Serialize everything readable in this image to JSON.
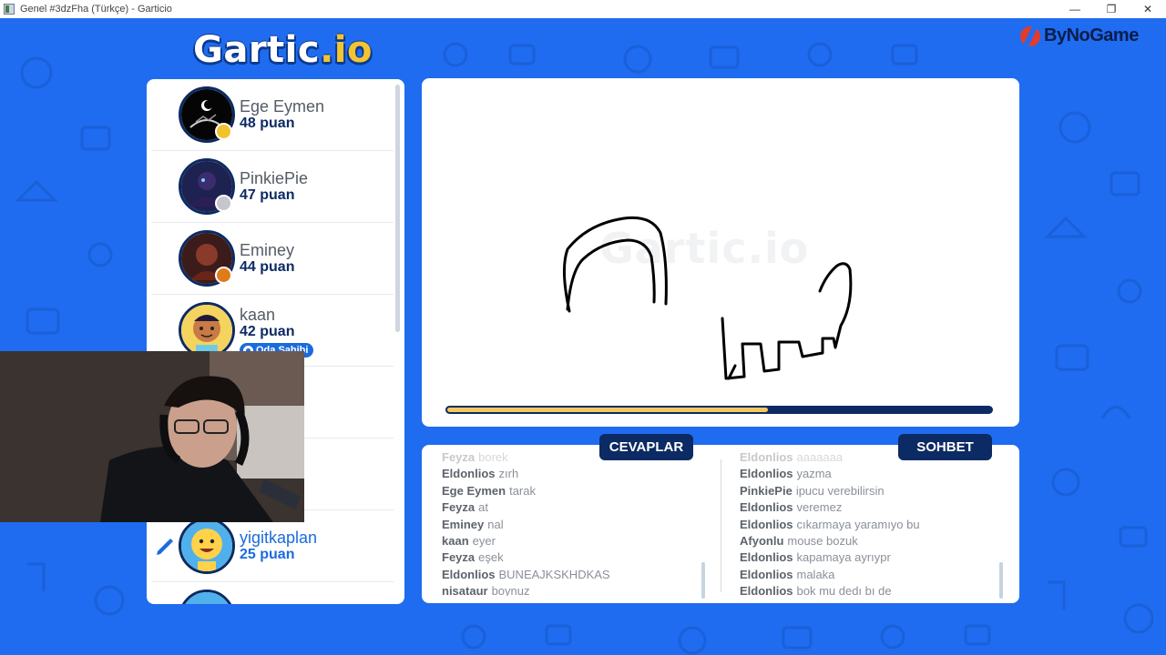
{
  "window": {
    "title": "Genel #3dzFha (Türkçe) - Garticio",
    "min_icon": "minimize-icon",
    "max_icon": "maximize-icon",
    "close_icon": "close-icon"
  },
  "logo": {
    "main": "Gartic",
    "suffix": ".io"
  },
  "sponsor": {
    "label": "ByNoGame"
  },
  "players": [
    {
      "name": "Ege Eymen",
      "score": "48 puan",
      "medal_color": "#f2c12e"
    },
    {
      "name": "PinkiePie",
      "score": "47 puan",
      "medal_color": "#c5c7cc"
    },
    {
      "name": "Eminey",
      "score": "44 puan",
      "medal_color": "#e07b1a"
    },
    {
      "name": "kaan",
      "score": "42 puan",
      "badge": "Oda Sahibi"
    },
    {
      "name": "yigitkaplan",
      "score": "25 puan",
      "drawing": true
    }
  ],
  "timer": {
    "progress": 0.59
  },
  "tabs": {
    "answers": "CEVAPLAR",
    "chat": "SOHBET"
  },
  "answers": [
    {
      "user": "Feyza",
      "text": "borek"
    },
    {
      "user": "Eldonlios",
      "text": "zırh"
    },
    {
      "user": "Ege Eymen",
      "text": "tarak"
    },
    {
      "user": "Feyza",
      "text": "at"
    },
    {
      "user": "Eminey",
      "text": "nal"
    },
    {
      "user": "kaan",
      "text": "eyer"
    },
    {
      "user": "Feyza",
      "text": "eşek"
    },
    {
      "user": "Eldonlios",
      "text": "BUNEAJKSKHDKAS"
    },
    {
      "user": "nisataur",
      "text": "boynuz"
    }
  ],
  "chat": [
    {
      "user": "Eldonlios",
      "text": "aaaaaaa"
    },
    {
      "user": "Eldonlios",
      "text": "yazma"
    },
    {
      "user": "PinkiePie",
      "text": "ipucu verebilirsin"
    },
    {
      "user": "Eldonlios",
      "text": "veremez"
    },
    {
      "user": "Eldonlios",
      "text": "cıkarmaya yaramıyo bu"
    },
    {
      "user": "Afyonlu",
      "text": "mouse bozuk"
    },
    {
      "user": "Eldonlios",
      "text": "kapamaya ayrıypr"
    },
    {
      "user": "Eldonlios",
      "text": "malaka"
    },
    {
      "user": "Eldonlios",
      "text": "bok mu dedı bı de"
    }
  ],
  "colors": {
    "background": "#1f6cf0",
    "navy": "#0c2a63",
    "accent_yellow": "#f3c95c"
  }
}
